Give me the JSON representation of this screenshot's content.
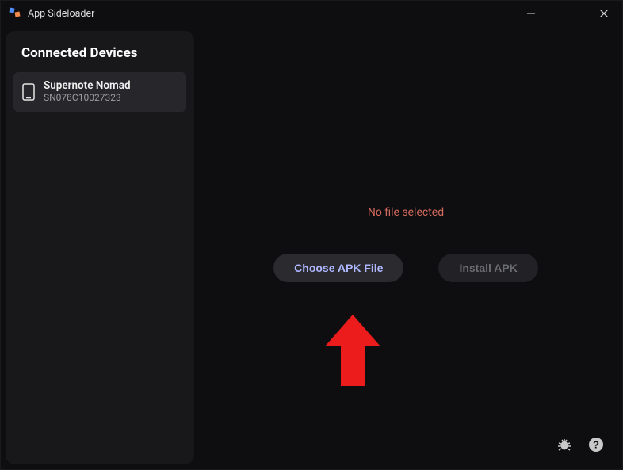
{
  "titlebar": {
    "app_title": "App Sideloader"
  },
  "sidebar": {
    "title": "Connected Devices",
    "devices": [
      {
        "name": "Supernote Nomad",
        "serial": "SN078C10027323"
      }
    ]
  },
  "main": {
    "status": "No file selected",
    "choose_label": "Choose APK File",
    "install_label": "Install APK"
  }
}
